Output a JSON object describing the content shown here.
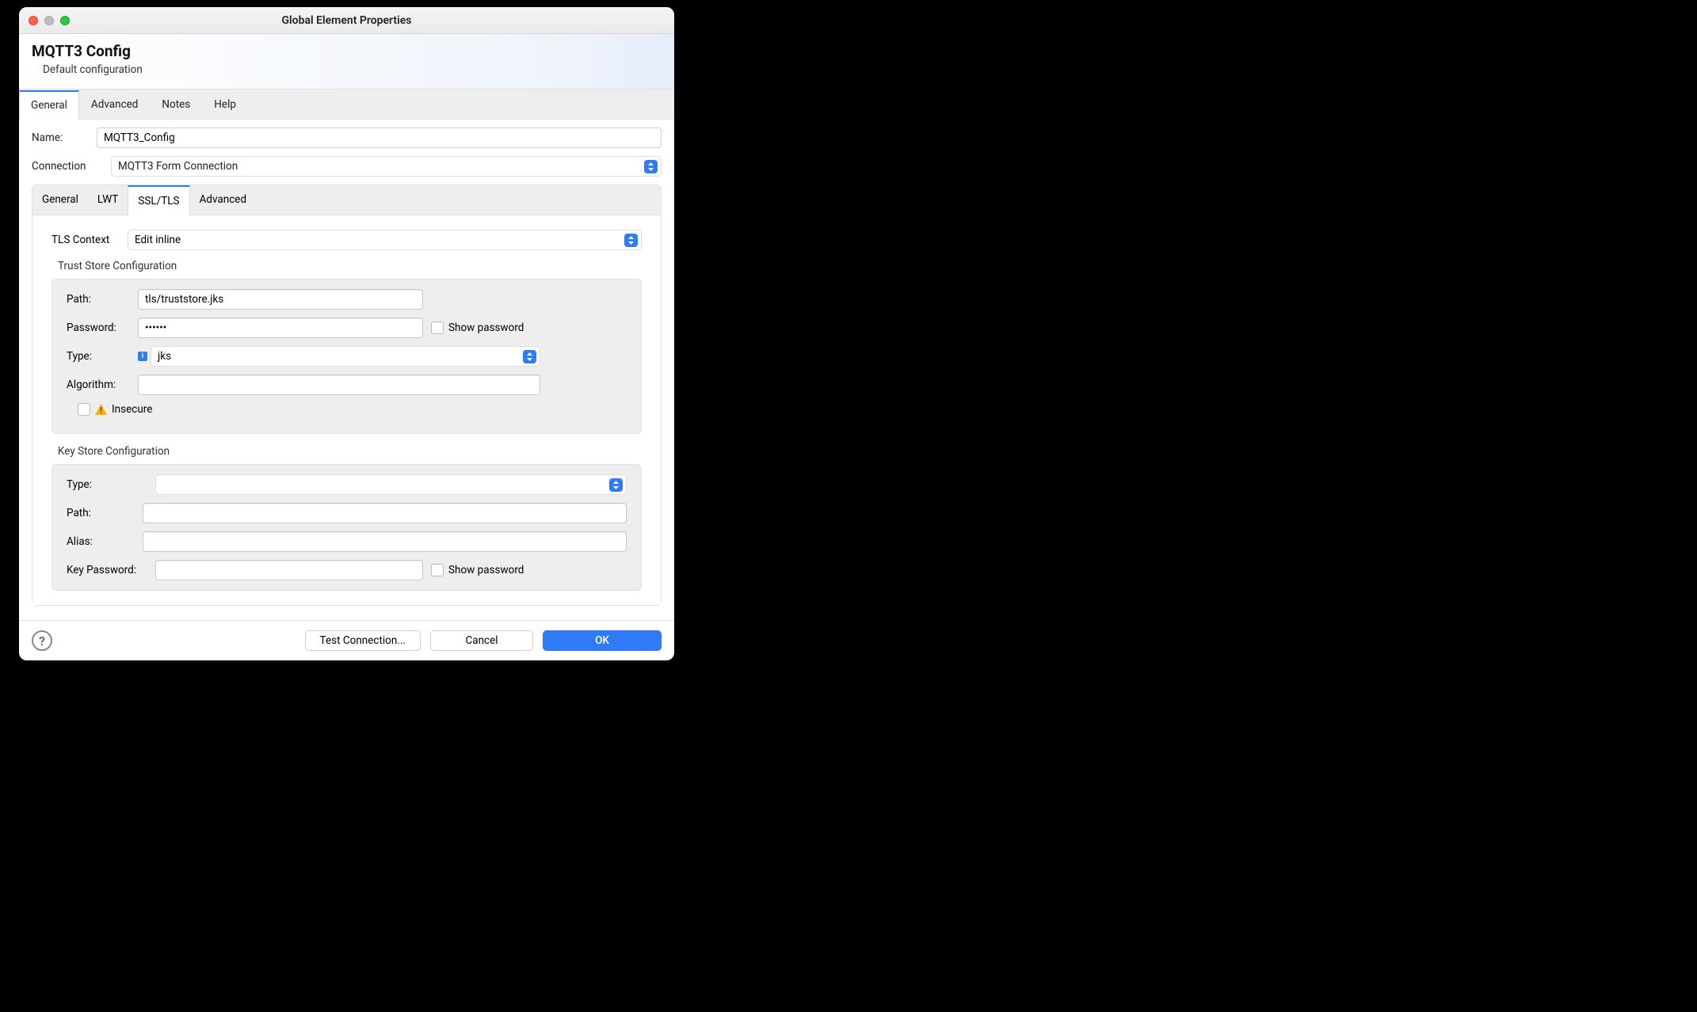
{
  "window": {
    "title": "Global Element Properties"
  },
  "header": {
    "title": "MQTT3 Config",
    "subtitle": "Default configuration"
  },
  "topTabs": [
    "General",
    "Advanced",
    "Notes",
    "Help"
  ],
  "topTabActiveIndex": 0,
  "name": {
    "label": "Name:",
    "value": "MQTT3_Config"
  },
  "connection": {
    "label": "Connection",
    "value": "MQTT3 Form Connection"
  },
  "innerTabs": [
    "General",
    "LWT",
    "SSL/TLS",
    "Advanced"
  ],
  "innerTabActiveIndex": 2,
  "tlsContext": {
    "label": "TLS Context",
    "value": "Edit inline"
  },
  "trustStore": {
    "title": "Trust Store Configuration",
    "path": {
      "label": "Path:",
      "value": "tls/truststore.jks"
    },
    "password": {
      "label": "Password:",
      "value": "••••••",
      "show_label": "Show password"
    },
    "type": {
      "label": "Type:",
      "value": "jks"
    },
    "algorithm": {
      "label": "Algorithm:",
      "value": ""
    },
    "insecure": {
      "label": "Insecure"
    }
  },
  "keyStore": {
    "title": "Key Store Configuration",
    "type": {
      "label": "Type:",
      "value": ""
    },
    "path": {
      "label": "Path:",
      "value": ""
    },
    "alias": {
      "label": "Alias:",
      "value": ""
    },
    "keyPassword": {
      "label": "Key Password:",
      "value": "",
      "show_label": "Show password"
    }
  },
  "footer": {
    "test": "Test Connection...",
    "cancel": "Cancel",
    "ok": "OK"
  }
}
